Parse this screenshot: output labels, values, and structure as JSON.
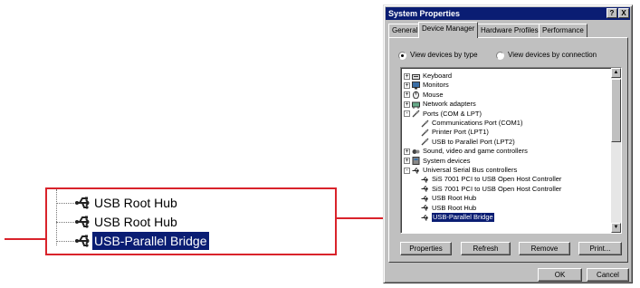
{
  "callout": {
    "items": [
      {
        "label": "USB Root Hub",
        "selected": false
      },
      {
        "label": "USB Root Hub",
        "selected": false
      },
      {
        "label": "USB-Parallel Bridge",
        "selected": true
      }
    ],
    "arrow_color": "#d9232b"
  },
  "window": {
    "title": "System Properties",
    "title_buttons": [
      "?",
      "X"
    ],
    "tabs": [
      {
        "label": "General",
        "active": false
      },
      {
        "label": "Device Manager",
        "active": true
      },
      {
        "label": "Hardware Profiles",
        "active": false
      },
      {
        "label": "Performance",
        "active": false
      }
    ],
    "view_options": {
      "by_type": "View devices by type",
      "by_connection": "View devices by connection",
      "selected": "by_type"
    },
    "tree": [
      {
        "label": "Keyboard",
        "level": 0,
        "expander": "+",
        "icon": "keyboard-icon"
      },
      {
        "label": "Monitors",
        "level": 0,
        "expander": "+",
        "icon": "monitor-icon"
      },
      {
        "label": "Mouse",
        "level": 0,
        "expander": "+",
        "icon": "mouse-icon"
      },
      {
        "label": "Network adapters",
        "level": 0,
        "expander": "+",
        "icon": "network-icon"
      },
      {
        "label": "Ports (COM & LPT)",
        "level": 0,
        "expander": "-",
        "icon": "port-icon"
      },
      {
        "label": "Communications Port (COM1)",
        "level": 1,
        "icon": "port-icon"
      },
      {
        "label": "Printer Port (LPT1)",
        "level": 1,
        "icon": "port-icon"
      },
      {
        "label": "USB to Parallel Port (LPT2)",
        "level": 1,
        "icon": "port-icon"
      },
      {
        "label": "Sound, video and game controllers",
        "level": 0,
        "expander": "+",
        "icon": "sound-icon"
      },
      {
        "label": "System devices",
        "level": 0,
        "expander": "+",
        "icon": "system-icon"
      },
      {
        "label": "Universal Serial Bus controllers",
        "level": 0,
        "expander": "-",
        "icon": "usb-icon"
      },
      {
        "label": "SiS 7001 PCI to USB Open Host Controller",
        "level": 1,
        "icon": "usb-icon"
      },
      {
        "label": "SiS 7001 PCI to USB Open Host Controller",
        "level": 1,
        "icon": "usb-icon"
      },
      {
        "label": "USB Root Hub",
        "level": 1,
        "icon": "usb-icon"
      },
      {
        "label": "USB Root Hub",
        "level": 1,
        "icon": "usb-icon"
      },
      {
        "label": "USB-Parallel Bridge",
        "level": 1,
        "icon": "usb-icon",
        "selected": true
      }
    ],
    "buttons": {
      "properties": "Properties",
      "refresh": "Refresh",
      "remove": "Remove",
      "print": "Print...",
      "ok": "OK",
      "cancel": "Cancel"
    },
    "colors": {
      "title_bar": "#0a1d73",
      "selection": "#0a1d73",
      "face": "#c0c0c0"
    }
  }
}
